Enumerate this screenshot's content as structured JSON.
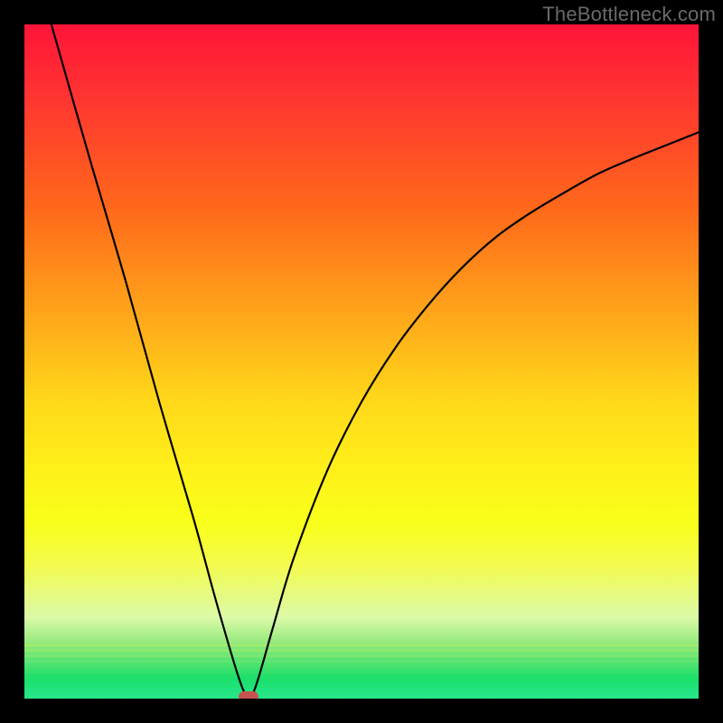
{
  "watermark": "TheBottleneck.com",
  "chart_data": {
    "type": "line",
    "title": "",
    "xlabel": "",
    "ylabel": "",
    "xlim": [
      0,
      100
    ],
    "ylim": [
      0,
      100
    ],
    "series": [
      {
        "name": "curve",
        "x": [
          4,
          10,
          15,
          20,
          25,
          28,
          30,
          31.5,
          32.5,
          33.3,
          34,
          35,
          37,
          40,
          45,
          50,
          55,
          60,
          65,
          70,
          75,
          80,
          85,
          90,
          95,
          100
        ],
        "y": [
          100,
          79,
          62,
          44,
          27,
          16,
          9,
          4,
          1.2,
          0.3,
          1,
          4,
          11,
          21,
          34,
          44,
          52,
          58.5,
          64,
          68.5,
          72,
          75,
          77.8,
          80,
          82,
          84
        ]
      }
    ],
    "marker": {
      "x": 33.3,
      "y": 0.3,
      "color": "#c8524f"
    },
    "gradient_stops": [
      {
        "pct": 0,
        "color": "#ff1438"
      },
      {
        "pct": 10,
        "color": "#ff3232"
      },
      {
        "pct": 28,
        "color": "#ff6b1a"
      },
      {
        "pct": 44,
        "color": "#ffaa1a"
      },
      {
        "pct": 56,
        "color": "#ffd81a"
      },
      {
        "pct": 66,
        "color": "#fff01a"
      },
      {
        "pct": 74,
        "color": "#f8ff1a"
      },
      {
        "pct": 80,
        "color": "#f4fb4c"
      },
      {
        "pct": 88,
        "color": "#dbfaa8"
      },
      {
        "pct": 92,
        "color": "#8fe87a"
      },
      {
        "pct": 97,
        "color": "#19e066"
      },
      {
        "pct": 100,
        "color": "#28e68a"
      }
    ]
  }
}
